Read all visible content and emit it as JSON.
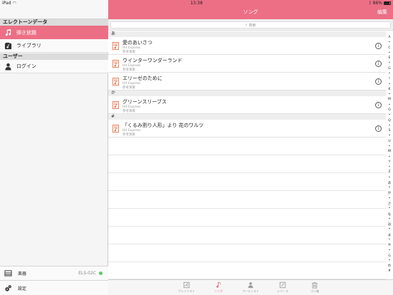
{
  "status_bar": {
    "device": "iPad",
    "time": "13:38",
    "battery": "86%"
  },
  "sidebar": {
    "section_electone": "エレクトーンデータ",
    "items": [
      {
        "label": "弾き放題",
        "icon": "music-note-icon",
        "active": true
      },
      {
        "label": "ライブラリ",
        "icon": "library-icon",
        "active": false
      }
    ],
    "section_user": "ユーザー",
    "login_label": "ログイン",
    "instrument_label": "楽器",
    "instrument_value": "ELS-02C",
    "settings_label": "設定"
  },
  "header": {
    "title": "ソング",
    "edit_label": "編集"
  },
  "search": {
    "placeholder": "検索"
  },
  "sections": [
    {
      "index": "あ",
      "songs": [
        {
          "title": "愛のあいさつ",
          "publisher": "Hit Express",
          "note": "参考演奏"
        },
        {
          "title": "ウインターワンダーランド",
          "publisher": "Hit Express",
          "note": "参考演奏"
        },
        {
          "title": "エリーゼのために",
          "publisher": "Hit Express",
          "note": "参考演奏"
        }
      ]
    },
    {
      "index": "か",
      "songs": [
        {
          "title": "グリーンスリーブス",
          "publisher": "Hit Express",
          "note": "参考演奏"
        }
      ]
    },
    {
      "index": "#",
      "songs": [
        {
          "title": "「くるみ割り人形」より 花のワルツ",
          "publisher": "Hit Express",
          "note": "参考演奏"
        }
      ]
    }
  ],
  "index_letters": [
    "A",
    "•",
    "C",
    "•",
    "E",
    "•",
    "G",
    "•",
    "I",
    "•",
    "K",
    "•",
    "M",
    "•",
    "O",
    "•",
    "Q",
    "•",
    "S",
    "•",
    "U",
    "•",
    "W",
    "•",
    "Y",
    "•",
    "Z",
    "•",
    "あ",
    "•",
    "か",
    "•",
    "さ",
    "•",
    "な",
    "•",
    "は",
    "•",
    "ま",
    "•",
    "や",
    "•",
    "ら",
    "•",
    "わ",
    "#"
  ],
  "tabs": [
    {
      "label": "プレイリスト",
      "icon": "playlist-icon",
      "active": false
    },
    {
      "label": "ソング",
      "icon": "music-note-icon",
      "active": true
    },
    {
      "label": "アーティスト",
      "icon": "artist-icon",
      "active": false
    },
    {
      "label": "シリーズ",
      "icon": "series-icon",
      "active": false
    },
    {
      "label": "ゴミ箱",
      "icon": "trash-icon",
      "active": false
    }
  ],
  "colors": {
    "accent": "#ec6f85",
    "song_icon": "#e8774f",
    "connected": "#5ecc62"
  }
}
